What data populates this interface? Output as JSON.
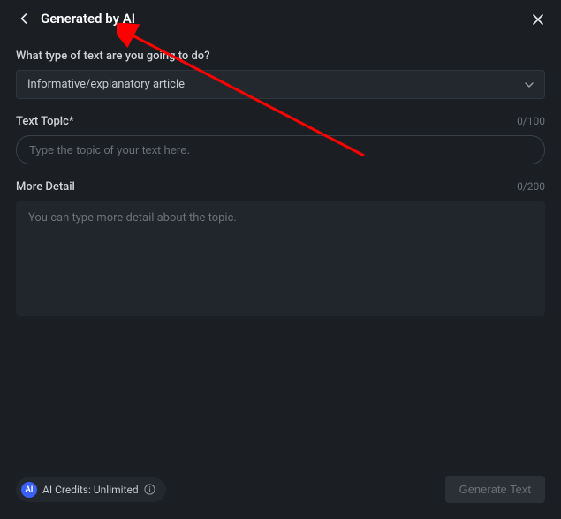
{
  "header": {
    "title": "Generated by AI"
  },
  "form": {
    "q1_label": "What type of text are you going to do?",
    "q1_value": "Informative/explanatory article",
    "topic_label": "Text Topic*",
    "topic_counter": "0/100",
    "topic_placeholder": "Type the topic of your text here.",
    "detail_label": "More Detail",
    "detail_counter": "0/200",
    "detail_placeholder": "You can type more detail about the topic."
  },
  "footer": {
    "ai_badge": "AI",
    "credits_label": "AI Credits: Unlimited",
    "generate_label": "Generate Text"
  },
  "annotation": {
    "arrow_color": "#ff0000"
  }
}
